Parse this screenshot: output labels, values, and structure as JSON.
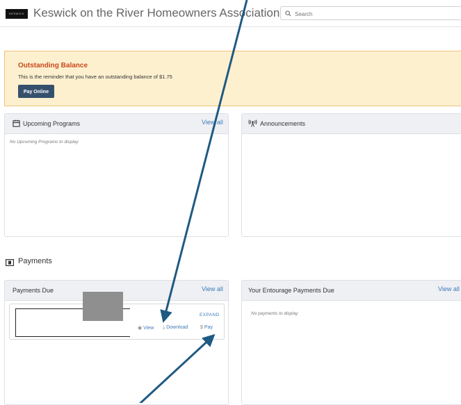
{
  "header": {
    "logo_text": "KESWICK",
    "title": "Keswick on the River Homeowners Association",
    "search_placeholder": "Search"
  },
  "alert": {
    "title": "Outstanding Balance",
    "message": "This is the reminder that you have an outstanding balance of $1.75",
    "button_label": "Pay Online",
    "bg_color": "#fdf0cf",
    "title_color": "#c9481a"
  },
  "programs": {
    "title": "Upcoming Programs",
    "view_all": "View all",
    "empty": "No Upcoming Programs to display",
    "icon": "calendar-icon"
  },
  "announcements": {
    "title": "Announcements",
    "icon": "broadcast-icon"
  },
  "payments_section": {
    "label": "Payments",
    "icon": "money-icon"
  },
  "payments_due": {
    "title": "Payments Due",
    "view_all": "View all",
    "card": {
      "expand": "EXPAND",
      "view": "View",
      "download": "Download",
      "pay": "Pay"
    }
  },
  "entourage": {
    "title": "Your Entourage Payments Due",
    "view_all": "View all",
    "empty": "No payments to display"
  },
  "colors": {
    "link": "#3d7ab8",
    "button": "#35506d",
    "arrow": "#1f5a82"
  }
}
